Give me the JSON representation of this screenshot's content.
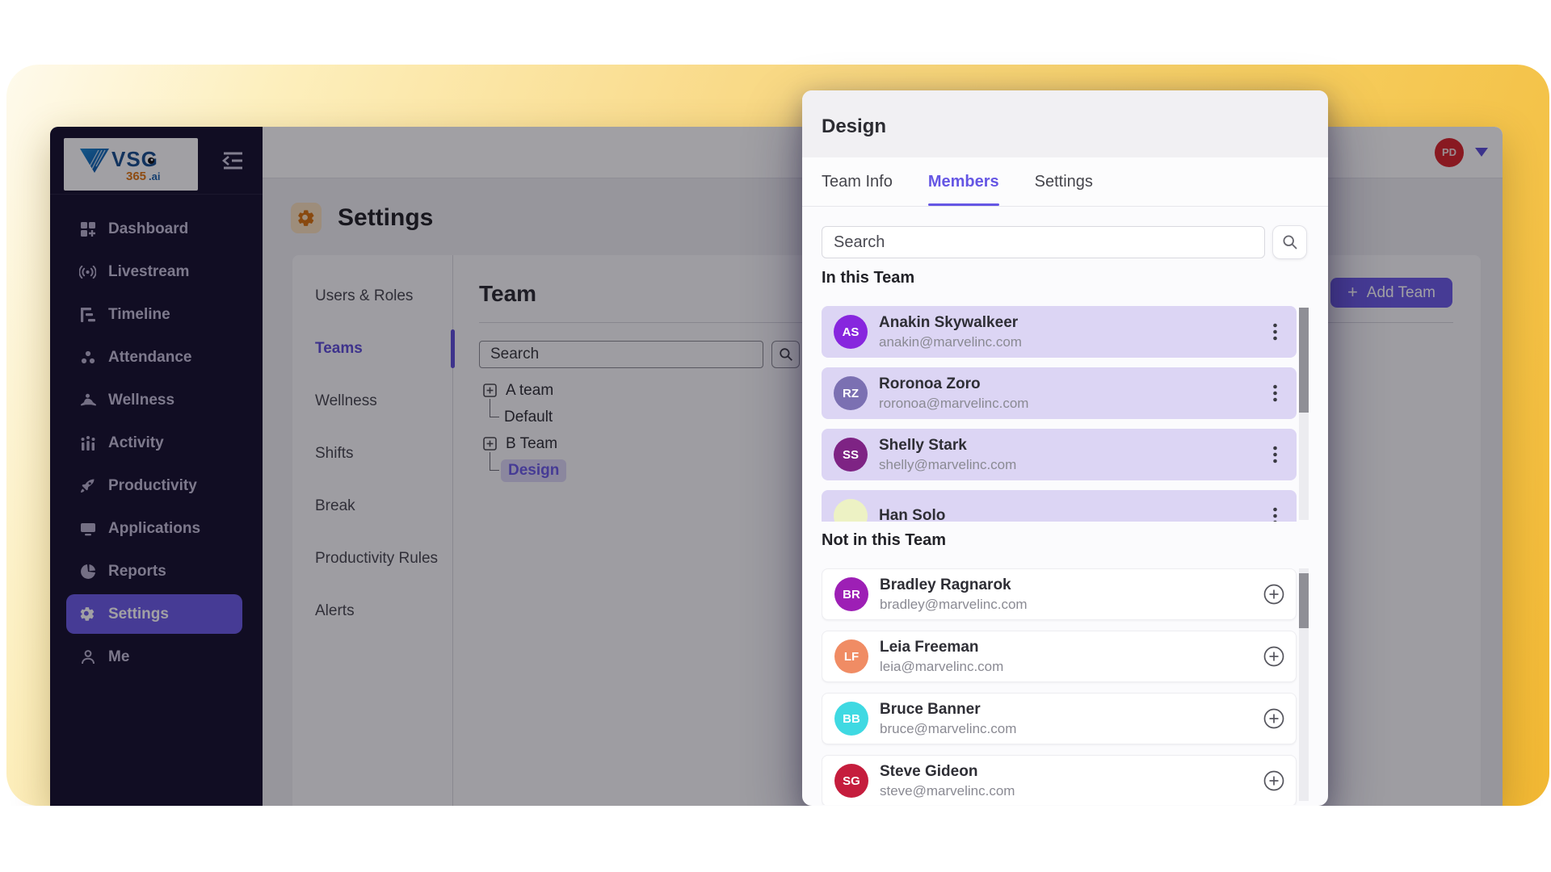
{
  "theme": {
    "accent_purple": "#6c5ce7",
    "sidebar_bg": "#1d1836",
    "yellow_start": "#fdf6dc",
    "yellow_end": "#f0b232",
    "gear_orange": "#d9730f",
    "avatar_red": "#b3121a"
  },
  "logo": {
    "brand": "VSG",
    "sub": "365",
    "sub_tld": ".ai"
  },
  "sidebar": {
    "items": [
      {
        "label": "Dashboard"
      },
      {
        "label": "Livestream"
      },
      {
        "label": "Timeline"
      },
      {
        "label": "Attendance"
      },
      {
        "label": "Wellness"
      },
      {
        "label": "Activity"
      },
      {
        "label": "Productivity"
      },
      {
        "label": "Applications"
      },
      {
        "label": "Reports"
      },
      {
        "label": "Settings"
      },
      {
        "label": "Me"
      }
    ]
  },
  "header": {
    "avatar_initials": "PD"
  },
  "page": {
    "title": "Settings"
  },
  "settings_nav": {
    "items": [
      {
        "label": "Users & Roles"
      },
      {
        "label": "Teams"
      },
      {
        "label": "Wellness"
      },
      {
        "label": "Shifts"
      },
      {
        "label": "Break"
      },
      {
        "label": "Productivity Rules"
      },
      {
        "label": "Alerts"
      }
    ]
  },
  "team_section": {
    "heading": "Team",
    "add_team_label": "Add Team",
    "search_placeholder": "Search",
    "tree": {
      "root1": "A team",
      "child1": "Default",
      "root2": "B Team",
      "child2": "Design"
    }
  },
  "modal": {
    "title": "Design",
    "tabs": [
      {
        "label": "Team Info"
      },
      {
        "label": "Members"
      },
      {
        "label": "Settings"
      }
    ],
    "search_placeholder": "Search",
    "in_team_label": "In this Team",
    "not_in_team_label": "Not in this Team",
    "in_team": [
      {
        "name": "Anakin Skywalkeer",
        "email": "anakin@marvelinc.com",
        "initials": "AS",
        "color": "#8726de"
      },
      {
        "name": "Roronoa Zoro",
        "email": "roronoa@marvelinc.com",
        "initials": "RZ",
        "color": "#7b70b2"
      },
      {
        "name": "Shelly Stark",
        "email": "shelly@marvelinc.com",
        "initials": "SS",
        "color": "#7e2384"
      },
      {
        "name": "Han Solo",
        "email": "",
        "initials": "",
        "color": "#edf2c4"
      }
    ],
    "not_in_team": [
      {
        "name": "Bradley Ragnarok",
        "email": "bradley@marvelinc.com",
        "initials": "BR",
        "color": "#9d1fb5"
      },
      {
        "name": "Leia Freeman",
        "email": "leia@marvelinc.com",
        "initials": "LF",
        "color": "#f08c64"
      },
      {
        "name": "Bruce Banner",
        "email": "bruce@marvelinc.com",
        "initials": "BB",
        "color": "#3fd9e2"
      },
      {
        "name": "Steve Gideon",
        "email": "steve@marvelinc.com",
        "initials": "SG",
        "color": "#c51d3d"
      }
    ]
  }
}
